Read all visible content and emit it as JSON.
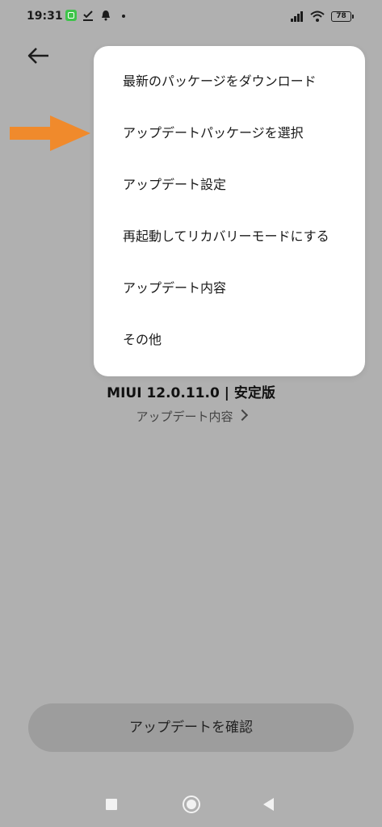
{
  "status_bar": {
    "time": "19:31",
    "battery": "78"
  },
  "menu": {
    "items": [
      "最新のパッケージをダウンロード",
      "アップデートパッケージを選択",
      "アップデート設定",
      "再起動してリカバリーモードにする",
      "アップデート内容",
      "その他"
    ]
  },
  "version": {
    "title": "MIUI 12.0.11.0 | 安定版",
    "details_link": "アップデート内容"
  },
  "confirm_button": "アップデートを確認",
  "colors": {
    "scrim": "#b0b0b0",
    "menu_bg": "#ffffff",
    "arrow": "#f08a2c",
    "button_bg": "#9d9d9d"
  }
}
